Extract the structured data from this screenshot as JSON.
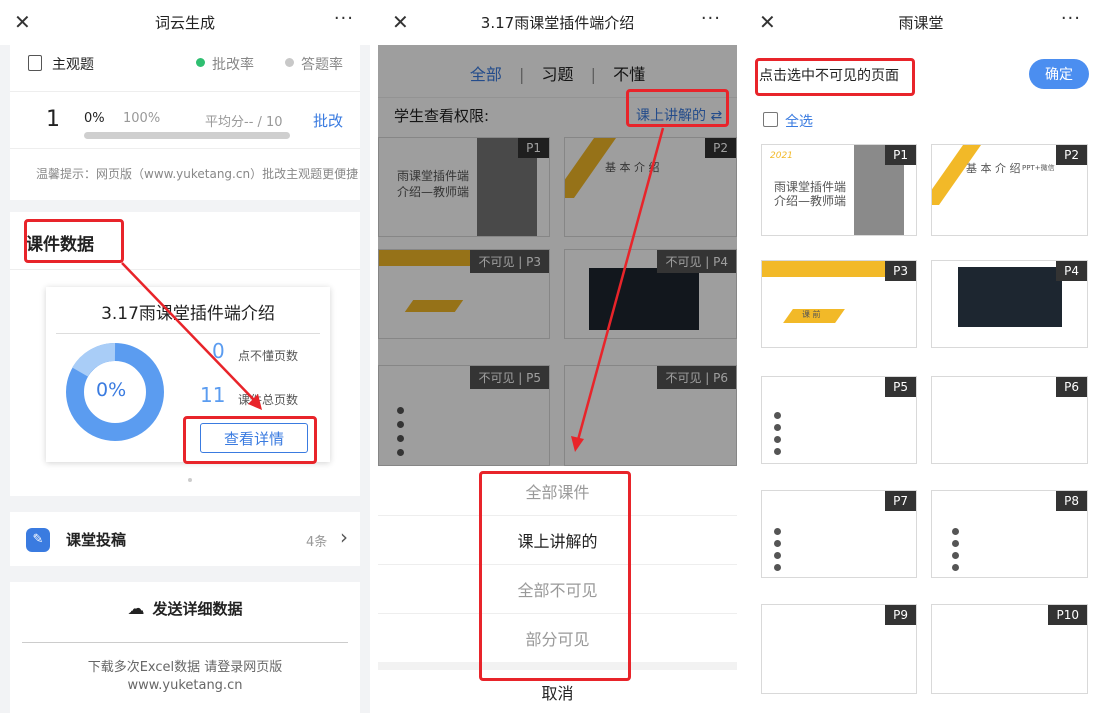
{
  "panel1": {
    "title": "词云生成",
    "close_icon": "close-icon",
    "more_label": "···",
    "subjective": {
      "label": "主观题",
      "legend_grade": "批改率",
      "legend_answer": "答题率",
      "row_num": "1",
      "pct_grade": "0%",
      "pct_answer": "100%",
      "avg": "平均分-- / 10",
      "grade_link": "批改",
      "tip": "温馨提示：网页版（www.yuketang.cn）批改主观题更便捷"
    },
    "courseware": {
      "heading": "课件数据",
      "card_title": "3.17雨课堂插件端介绍",
      "donut_pct": "0%",
      "not_understand_num": "0",
      "not_understand_label": "点不懂页数",
      "total_num": "11",
      "total_label": "课件总页数",
      "details_button": "查看详情"
    },
    "submission": {
      "label": "课堂投稿",
      "count": "4条"
    },
    "send": {
      "label": "发送详细数据",
      "note_line1": "下载多次Excel数据 请登录网页版",
      "note_line2": "www.yuketang.cn"
    }
  },
  "panel2": {
    "title": "3.17雨课堂插件端介绍",
    "more_label": "···",
    "tabs": [
      "全部",
      "习题",
      "不懂"
    ],
    "permission_label": "学生查看权限:",
    "permission_value": "课上讲解的 ⇄",
    "pages": [
      "P1",
      "P2",
      "P3",
      "P4",
      "P5",
      "P6"
    ],
    "invisible_label": "不可见",
    "options": [
      "全部课件",
      "课上讲解的",
      "全部不可见",
      "部分可见"
    ],
    "cancel": "取消"
  },
  "panel3": {
    "title": "雨课堂",
    "more_label": "···",
    "instruction": "点击选中不可见的页面",
    "confirm": "确定",
    "select_all": "全选",
    "pages": [
      "P1",
      "P2",
      "P3",
      "P4",
      "P5",
      "P6",
      "P7",
      "P8",
      "P9",
      "P10"
    ]
  },
  "slides": {
    "s1_year": "2021",
    "s1_title_line1": "雨课堂插件端",
    "s1_title_line2": "介绍—教师端",
    "s2_title": "基 本 介 绍",
    "s2_tag": "PPT+微信",
    "s3_label": "课 前"
  },
  "colors": {
    "accent_blue": "#3a7be0",
    "donut_blue": "#5b9cf0",
    "annotation_red": "#e8242a",
    "slide_yellow": "#f2b928"
  }
}
